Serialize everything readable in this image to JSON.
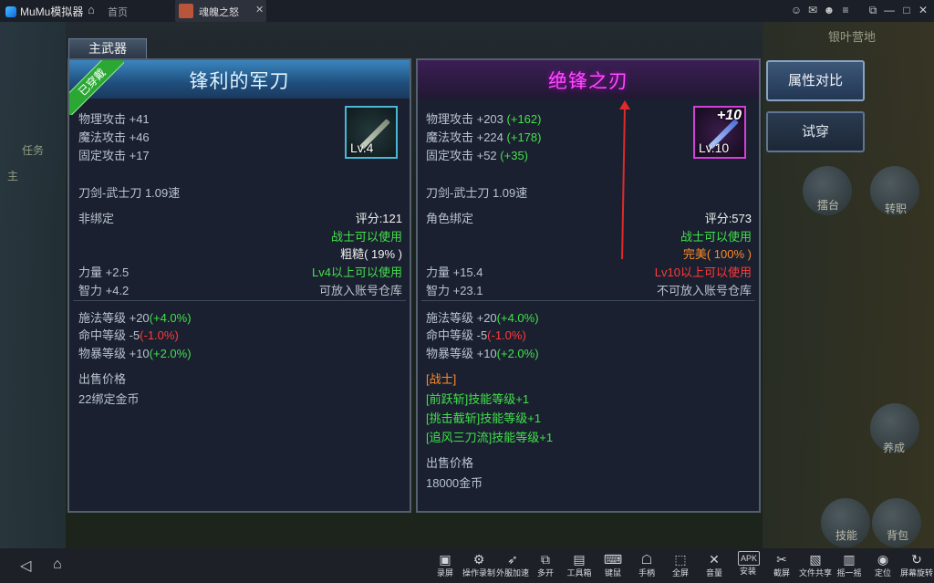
{
  "titlebar": {
    "app_name": "MuMu模拟器",
    "home_tab": "首页",
    "game_tab": "魂魄之怒",
    "controls": [
      "☺",
      "✉",
      "☻",
      "≡",
      "⧉",
      "—",
      "□",
      "✕"
    ]
  },
  "game_bg": {
    "location": "银叶营地",
    "side_texts": [
      "任务",
      "主"
    ],
    "round_buttons": [
      "擂台",
      "转职",
      "养成",
      "技能",
      "背包"
    ]
  },
  "tab_label": "主武器",
  "left_panel": {
    "badge": "已穿戴",
    "title": "锋利的军刀",
    "icon_level": "Lv.4",
    "stats": [
      {
        "text": "物理攻击 +41",
        "bonus": ""
      },
      {
        "text": "魔法攻击 +46",
        "bonus": ""
      },
      {
        "text": "固定攻击 +17",
        "bonus": ""
      }
    ],
    "weapon_type": "刀剑-武士刀 1.09速",
    "bind": "非绑定",
    "score": "评分:121",
    "class_req": "战士可以使用",
    "quality": "粗糙( 19% )",
    "strength": "力量 +2.5",
    "level_req": "Lv4以上可以使用",
    "intellect": "智力 +4.2",
    "storage": "可放入账号仓库",
    "extra": [
      {
        "label": "施法等级 +20",
        "value": "(+4.0%)"
      },
      {
        "label": "命中等级 -5",
        "value": "(-1.0%)"
      },
      {
        "label": "物暴等级 +10",
        "value": "(+2.0%)"
      }
    ],
    "price_label": "出售价格",
    "price": "22绑定金币"
  },
  "right_panel": {
    "title": "绝锋之刃",
    "icon_level": "Lv.10",
    "icon_plus": "+10",
    "stats": [
      {
        "text": "物理攻击 +203",
        "bonus": "(+162)"
      },
      {
        "text": "魔法攻击 +224",
        "bonus": "(+178)"
      },
      {
        "text": "固定攻击 +52",
        "bonus": "(+35)"
      }
    ],
    "weapon_type": "刀剑-武士刀 1.09速",
    "bind": "角色绑定",
    "score": "评分:573",
    "class_req": "战士可以使用",
    "quality": "完美( 100% )",
    "strength": "力量 +15.4",
    "level_req": "Lv10以上可以使用",
    "intellect": "智力 +23.1",
    "storage": "不可放入账号仓库",
    "extra": [
      {
        "label": "施法等级 +20",
        "value": "(+4.0%)"
      },
      {
        "label": "命中等级 -5",
        "value": "(-1.0%)"
      },
      {
        "label": "物暴等级 +10",
        "value": "(+2.0%)"
      }
    ],
    "set_class": "[战士]",
    "skills": [
      "[前跃斩]技能等级+1",
      "[挑击截斩]技能等级+1",
      "[追风三刀流]技能等级+1"
    ],
    "price_label": "出售价格",
    "price": "18000金币"
  },
  "buttons": {
    "compare": "属性对比",
    "try_on": "试穿"
  },
  "bottombar": {
    "nav": [
      "◁",
      "⌂"
    ],
    "tools": [
      {
        "icon": "▣",
        "label": "录屏"
      },
      {
        "icon": "⚙",
        "label": "操作录制"
      },
      {
        "icon": "➶",
        "label": "外服加速"
      },
      {
        "icon": "⧉",
        "label": "多开"
      },
      {
        "icon": "▤",
        "label": "工具箱"
      },
      {
        "icon": "⌨",
        "label": "键鼠"
      },
      {
        "icon": "☖",
        "label": "手柄"
      },
      {
        "icon": "⬚",
        "label": "全屏"
      },
      {
        "icon": "✕",
        "label": "音量"
      },
      {
        "icon": "APK",
        "label": "安装"
      },
      {
        "icon": "✂",
        "label": "截屏"
      },
      {
        "icon": "▧",
        "label": "文件共享"
      },
      {
        "icon": "▥",
        "label": "摇一摇"
      },
      {
        "icon": "◉",
        "label": "定位"
      },
      {
        "icon": "↻",
        "label": "屏幕旋转"
      }
    ]
  }
}
